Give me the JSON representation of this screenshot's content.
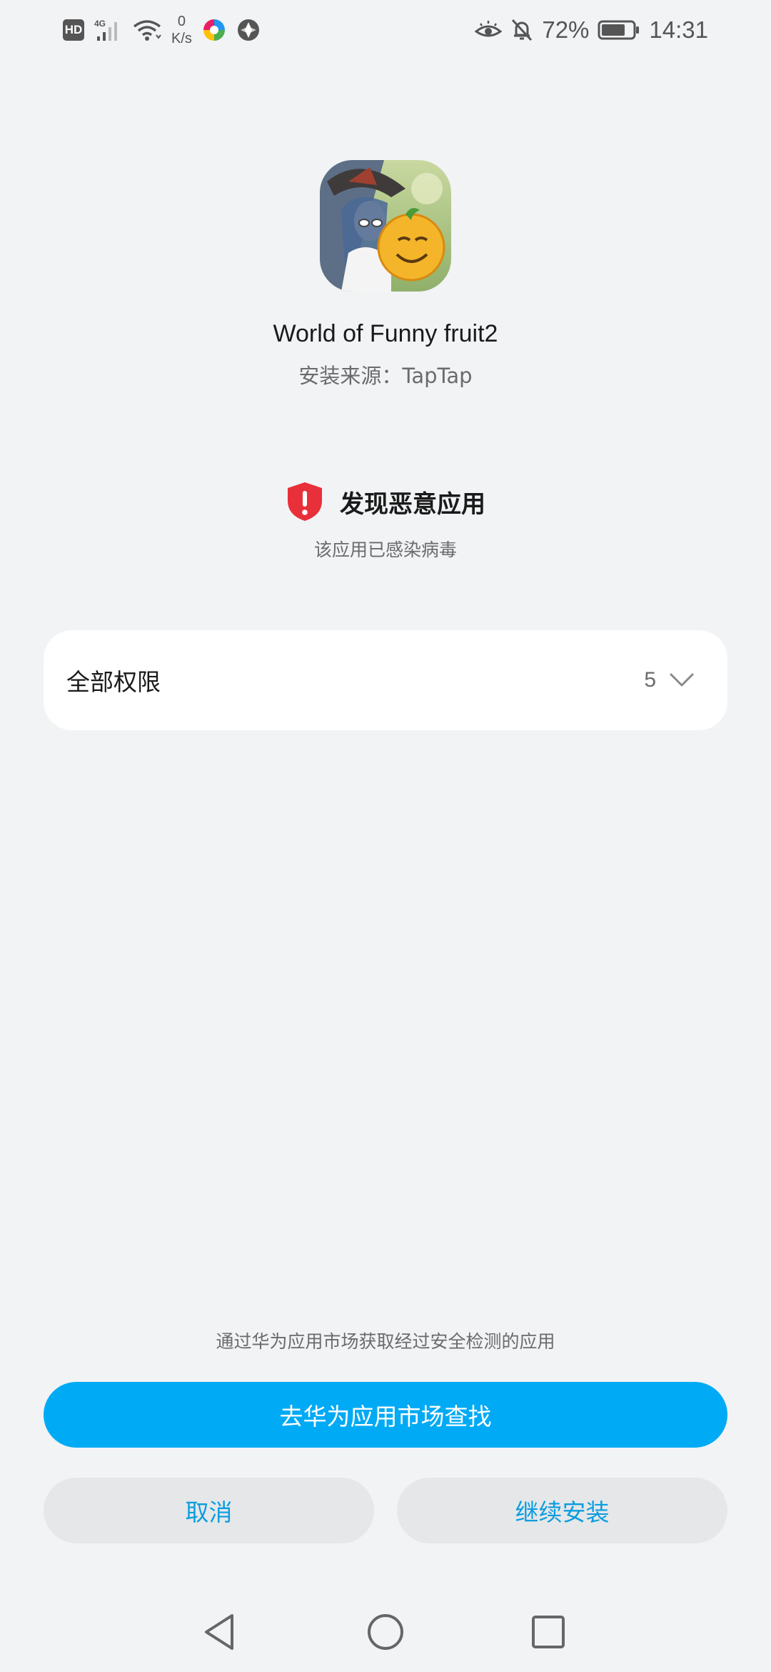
{
  "status_bar": {
    "hd_label": "HD",
    "network_type": "4G",
    "net_speed_value": "0",
    "net_speed_unit": "K/s",
    "battery_percent": "72%",
    "time": "14:31",
    "icons": [
      "hd-icon",
      "signal-icon",
      "wifi-icon",
      "app-notification-icon",
      "app-notification-icon",
      "eye-comfort-icon",
      "bell-off-icon",
      "battery-icon"
    ]
  },
  "app": {
    "name": "World of Funny fruit2",
    "source": "安装来源：TapTap"
  },
  "warning": {
    "title": "发现恶意应用",
    "subtitle": "该应用已感染病毒",
    "icon": "shield-alert-icon",
    "color": "#e8303a"
  },
  "permissions": {
    "label": "全部权限",
    "count": "5"
  },
  "bottom": {
    "hint": "通过华为应用市场获取经过安全检测的应用",
    "primary_button": "去华为应用市场查找",
    "cancel_button": "取消",
    "continue_button": "继续安装"
  },
  "colors": {
    "background": "#f1f3f5",
    "accent": "#00aaf5",
    "secondary_text": "#0a9de0"
  },
  "nav": {
    "icons": [
      "back-icon",
      "home-icon",
      "recents-icon"
    ]
  }
}
